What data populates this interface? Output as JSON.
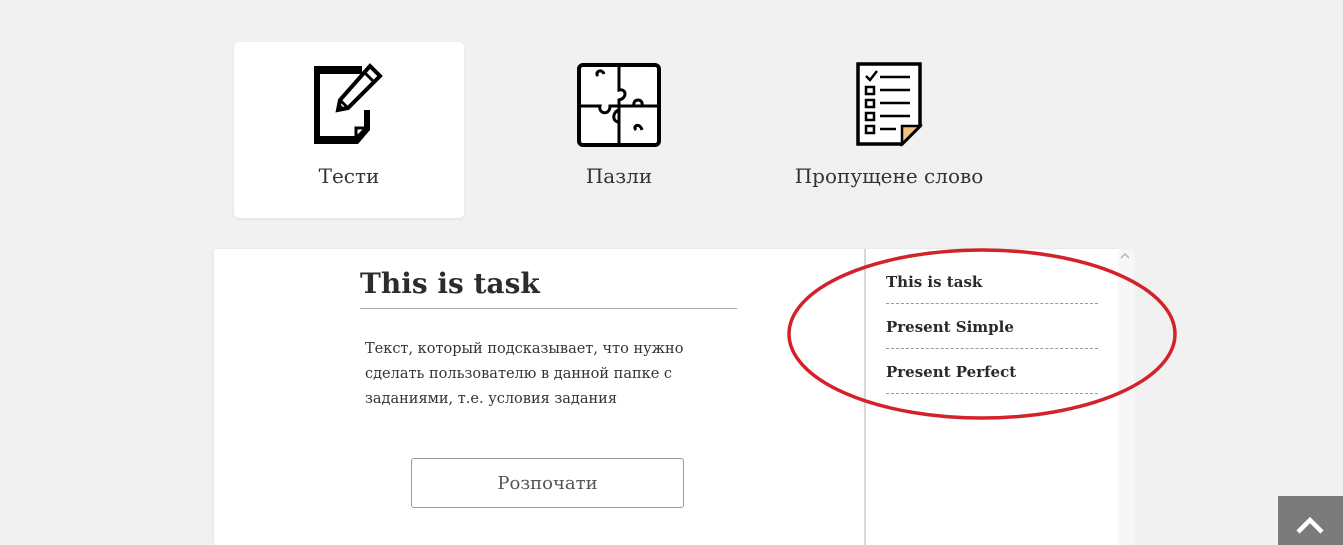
{
  "categories": [
    {
      "label": "Тести",
      "icon": "document-pencil-icon",
      "active": true
    },
    {
      "label": "Пазли",
      "icon": "puzzle-icon",
      "active": false
    },
    {
      "label": "Пропущене слово",
      "icon": "checklist-icon",
      "active": false
    }
  ],
  "task": {
    "title": "This is task",
    "description": "Текст, который подсказывает, что нужно сделать пользователю в данной папке с заданиями, т.е. условия задания",
    "start_label": "Розпочати"
  },
  "side_list": {
    "items": [
      "This is task",
      "Present Simple",
      "Present Perfect"
    ]
  },
  "colors": {
    "background": "#f1f1f1",
    "annotation": "#d2232a",
    "back_to_top": "#7b7b7b"
  },
  "icons": {
    "scroll_up": "caret-up-icon",
    "back_to_top": "chevron-up-icon"
  }
}
